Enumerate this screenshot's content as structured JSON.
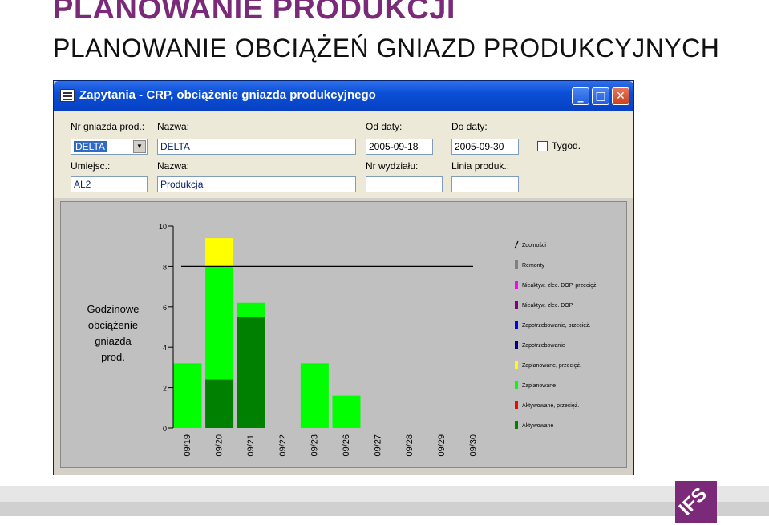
{
  "slide": {
    "title": "PLANOWANIE PRODUKCJI",
    "subtitle": "PLANOWANIE OBCIĄŻEŃ GNIAZD PRODUKCYJNYCH",
    "logo_text": "IFS"
  },
  "window": {
    "title": "Zapytania - CRP, obciążenie gniazda produkcyjnego",
    "buttons": {
      "minimize": "_",
      "maximize": "□",
      "close": "✕"
    }
  },
  "form": {
    "work_center_label": "Nr gniazda prod.:",
    "work_center_value": "DELTA",
    "name_label": "Nazwa:",
    "name_value": "DELTA",
    "from_date_label": "Od daty:",
    "from_date_value": "2005-09-18",
    "to_date_label": "Do daty:",
    "to_date_value": "2005-09-30",
    "week_label": "Tygod.",
    "location_label": "Umiejsc.:",
    "location_value": "AL2",
    "location_name_label": "Nazwa:",
    "location_name_value": "Produkcja",
    "department_label": "Nr wydziału:",
    "department_value": "",
    "line_label": "Linia produk.:",
    "line_value": ""
  },
  "chart_data": {
    "type": "bar",
    "ylabel": "Godzinowe obciążenie gniazda prod.",
    "ylim": [
      0,
      10
    ],
    "yticks": [
      0,
      2,
      4,
      6,
      8,
      10
    ],
    "capacity_line": 8,
    "categories": [
      "09/19",
      "09/20",
      "09/21",
      "09/22",
      "09/23",
      "09/26",
      "09/27",
      "09/28",
      "09/29",
      "09/30"
    ],
    "series": [
      {
        "name": "Aktywowane",
        "color": "#008000",
        "values": [
          0,
          2.4,
          5.5,
          0,
          0,
          0,
          0,
          0,
          0,
          0
        ]
      },
      {
        "name": "Zaplanowane",
        "color": "#00ff00",
        "values": [
          3.2,
          5.6,
          0.7,
          0,
          3.2,
          1.6,
          0,
          0,
          0,
          0
        ]
      },
      {
        "name": "Zaplanowane, przecięż.",
        "color": "#ffff00",
        "values": [
          0,
          1.4,
          0,
          0,
          0,
          0,
          0,
          0,
          0,
          0
        ]
      }
    ],
    "legend": [
      {
        "name": "Zdolności",
        "color": "#000000",
        "marker": "line"
      },
      {
        "name": "Remonty",
        "color": "#808080",
        "marker": "box"
      },
      {
        "name": "Nieaktyw. zlec. DOP, przecięż.",
        "color": "#ff00ff",
        "marker": "box"
      },
      {
        "name": "Nieaktyw. zlec. DOP",
        "color": "#800080",
        "marker": "box"
      },
      {
        "name": "Zapotrzebowanie, przecięż.",
        "color": "#0000ff",
        "marker": "box"
      },
      {
        "name": "Zapotrzebowanie",
        "color": "#000080",
        "marker": "box"
      },
      {
        "name": "Zaplanowane, przecięż.",
        "color": "#ffff00",
        "marker": "box"
      },
      {
        "name": "Zaplanowane",
        "color": "#00ff00",
        "marker": "box"
      },
      {
        "name": "Aktywowane, przecięż.",
        "color": "#ff0000",
        "marker": "box"
      },
      {
        "name": "Aktywowane",
        "color": "#008000",
        "marker": "box"
      }
    ]
  }
}
